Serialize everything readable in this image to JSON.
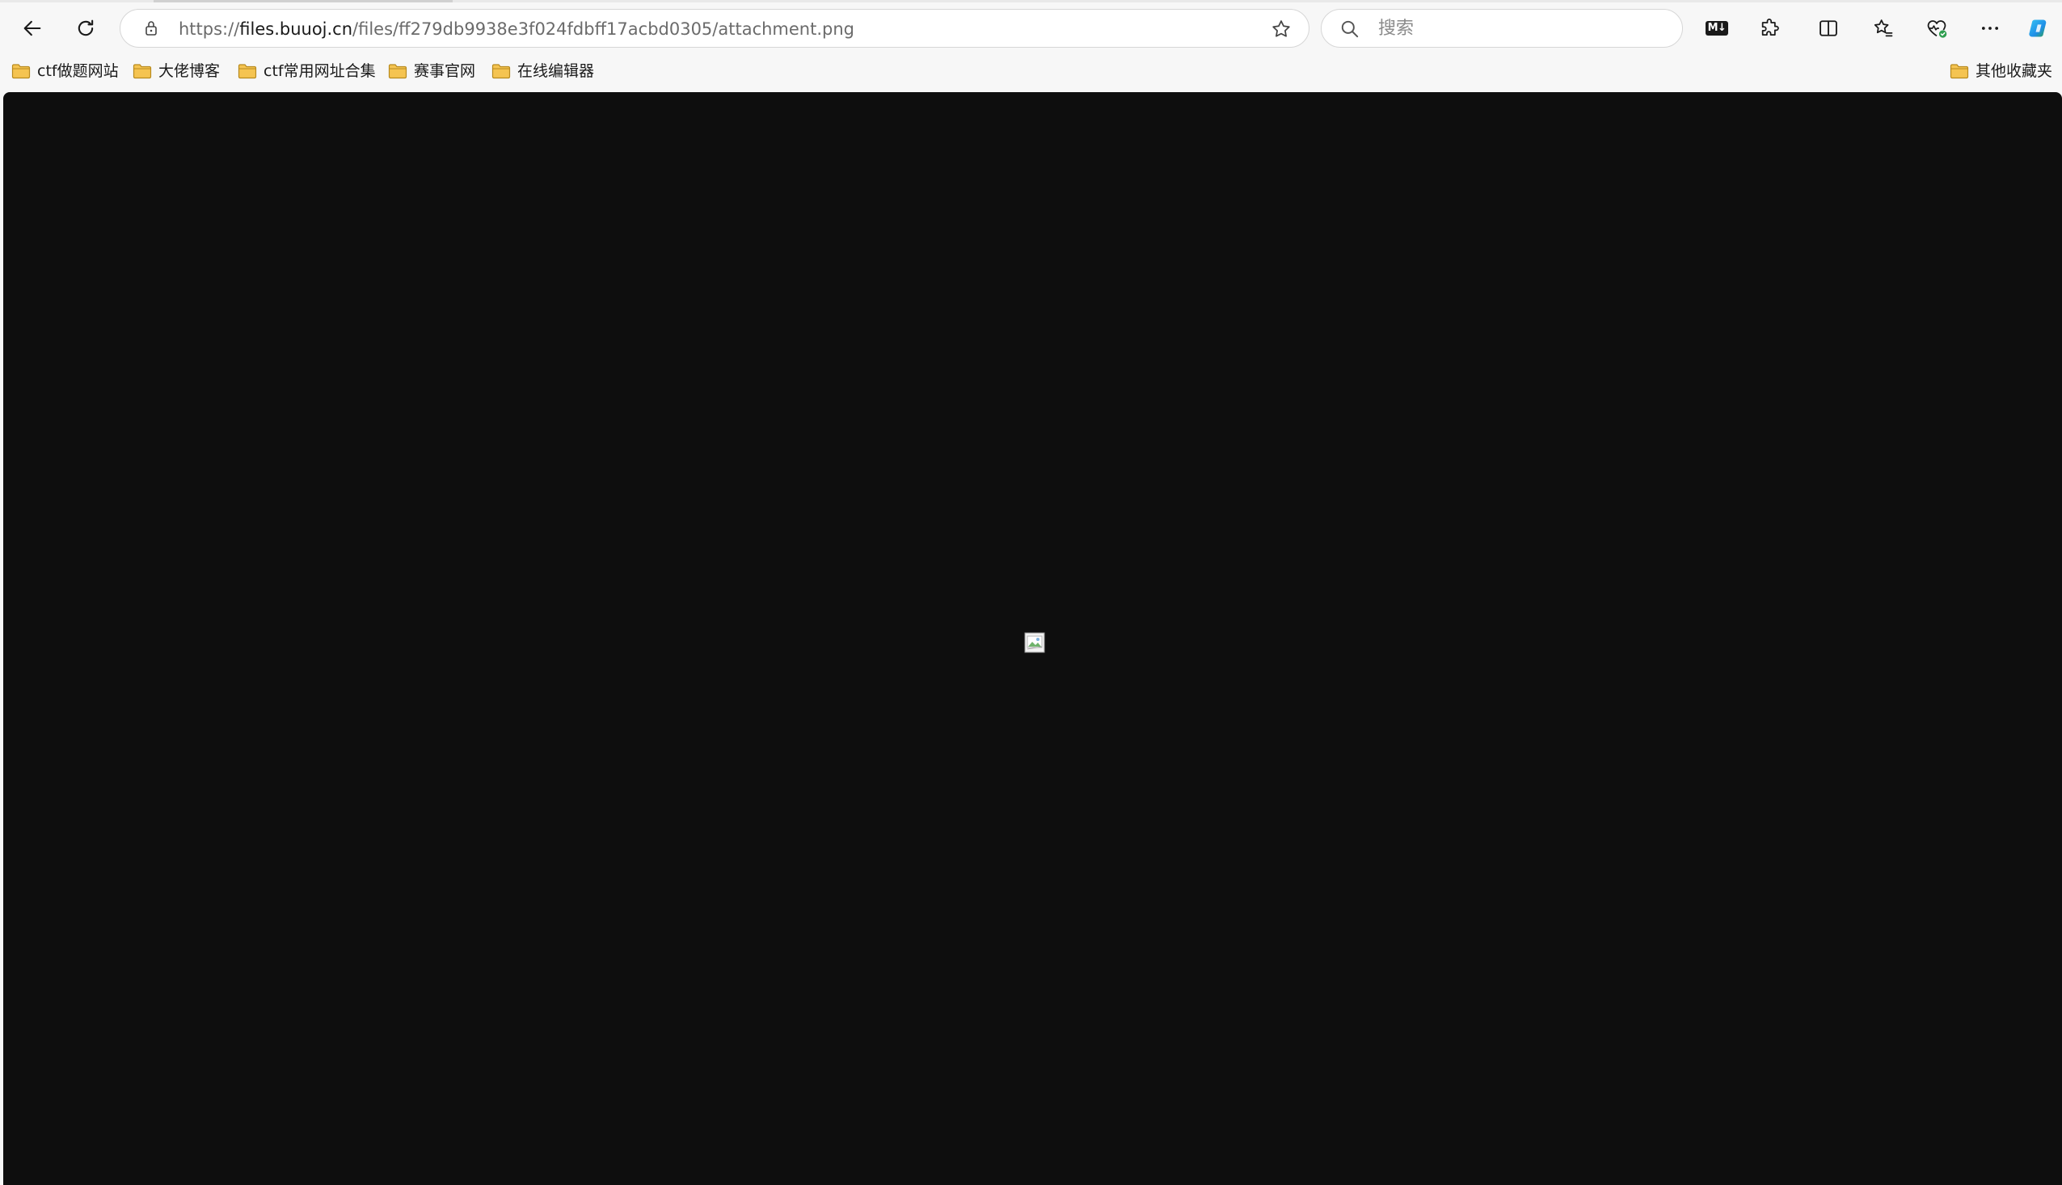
{
  "browser": {
    "address_bar": {
      "url_prefix": "https://",
      "url_host": "files.buuoj.cn",
      "url_path": "/files/ff279db9938e3f024fdbff17acbd0305/attachment.png"
    },
    "search": {
      "placeholder": "搜索"
    },
    "toolbar": {
      "markdown_badge": "M↓"
    }
  },
  "bookmarks": {
    "items": [
      {
        "label": "ctf做题网站"
      },
      {
        "label": "大佬博客"
      },
      {
        "label": "ctf常用网址合集"
      },
      {
        "label": "赛事官网"
      },
      {
        "label": "在线编辑器"
      }
    ],
    "other": {
      "label": "其他收藏夹"
    }
  },
  "colors": {
    "viewport_background": "#0e0e0e",
    "chrome_background": "#f7f7f7",
    "folder_fill": "#f5c451",
    "copilot_blue": "#1f8fe8"
  }
}
